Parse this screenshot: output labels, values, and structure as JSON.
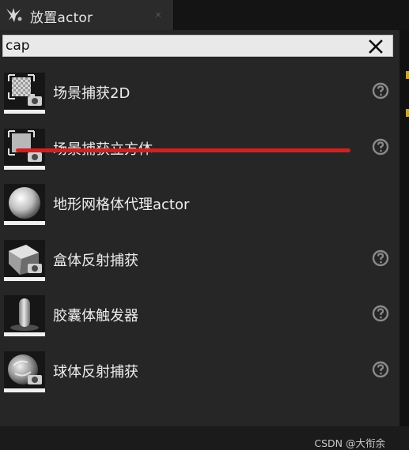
{
  "window": {
    "title": "放置actor",
    "close_glyph": "×"
  },
  "search": {
    "value": "cap",
    "clear_icon": "close-icon"
  },
  "results": [
    {
      "label": "场景捕获2D",
      "icon": "scene-capture-2d-icon",
      "has_help": true
    },
    {
      "label": "场景捕获立方体",
      "icon": "scene-capture-cube-icon",
      "has_help": true
    },
    {
      "label": "地形网格体代理actor",
      "icon": "landscape-mesh-proxy-icon",
      "has_help": false
    },
    {
      "label": "盒体反射捕获",
      "icon": "box-reflection-capture-icon",
      "has_help": true
    },
    {
      "label": "胶囊体触发器",
      "icon": "capsule-trigger-icon",
      "has_help": true
    },
    {
      "label": "球体反射捕获",
      "icon": "sphere-reflection-capture-icon",
      "has_help": true
    }
  ],
  "annotation": {
    "color": "#d41f1f"
  },
  "watermark": "CSDN @大衔余"
}
